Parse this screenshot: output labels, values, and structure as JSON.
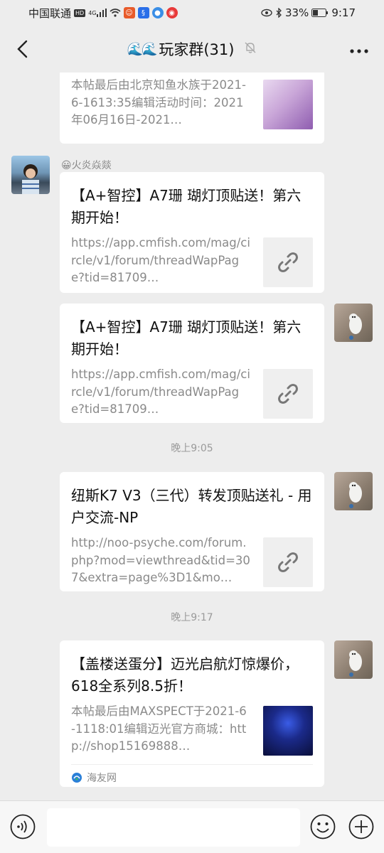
{
  "status_bar": {
    "carrier": "中国联通",
    "hd": "HD",
    "network": "4G",
    "battery": "33%",
    "time": "9:17"
  },
  "nav": {
    "title": "玩家群(31)"
  },
  "messages": [
    {
      "side": "left",
      "desc": "本帖最后由北京知鱼水族于2021-6-1613:35编辑活动时间：2021年06月16日-2021…"
    },
    {
      "side": "left",
      "sender": "😀火炎焱燚",
      "title": "【A+智控】A7珊 瑚灯顶贴送！第六期开始！",
      "desc": "https://app.cmfish.com/mag/circle/v1/forum/threadWapPage?tid=81709…"
    },
    {
      "side": "right",
      "title": "【A+智控】A7珊 瑚灯顶贴送！第六期开始！",
      "desc": "https://app.cmfish.com/mag/circle/v1/forum/threadWapPage?tid=81709…"
    },
    {
      "time": "晚上9:05"
    },
    {
      "side": "right",
      "title": "纽斯K7 V3（三代）转发顶贴送礼 - 用户交流-NP",
      "desc": "http://noo-psyche.com/forum.php?mod=viewthread&tid=307&extra=page%3D1&mo…"
    },
    {
      "time": "晚上9:17"
    },
    {
      "side": "right",
      "title": "【盖楼送蛋分】迈光启航灯惊爆价，618全系列8.5折！",
      "desc": "本帖最后由MAXSPECT于2021-6-1118:01编辑迈光官方商城：http://shop15169888…",
      "source": "海友网"
    }
  ],
  "icons": {
    "back": "chevron-left-icon",
    "mute": "bell-off-icon",
    "more": "more-icon",
    "link": "link-icon",
    "voice": "voice-icon",
    "emoji": "emoji-icon",
    "plus": "plus-icon"
  }
}
